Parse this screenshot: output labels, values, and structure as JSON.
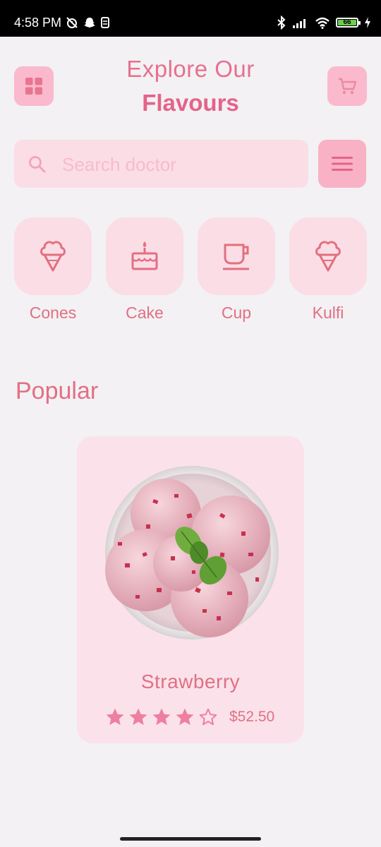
{
  "status_bar": {
    "time": "4:58 PM",
    "battery": "66",
    "left_icons": [
      "alarm-off-icon",
      "snapchat-icon",
      "sim-icon"
    ],
    "right_icons": [
      "bluetooth-icon",
      "signal-icon",
      "wifi-icon",
      "battery-icon",
      "charging-icon"
    ]
  },
  "header": {
    "title_line1": "Explore Our",
    "title_line2": "Flavours",
    "menu_icon": "grid-menu-icon",
    "cart_icon": "cart-icon"
  },
  "search": {
    "placeholder": "Search doctor",
    "icon": "search-icon",
    "filter_icon": "hamburger-icon"
  },
  "categories": [
    {
      "label": "Cones",
      "icon": "ice-cream-cone-icon"
    },
    {
      "label": "Cake",
      "icon": "cake-icon"
    },
    {
      "label": "Cup",
      "icon": "cup-icon"
    },
    {
      "label": "Kulfi",
      "icon": "ice-cream-cone-icon"
    }
  ],
  "popular": {
    "title": "Popular",
    "products": [
      {
        "name": "Strawberry",
        "price": "$52.50",
        "rating": 4,
        "rating_max": 5
      }
    ]
  },
  "colors": {
    "accent": "#e4638a",
    "text": "#e07084",
    "tile": "#fbdde6",
    "button": "#fbb9cd",
    "background": "#f3f1f3"
  }
}
